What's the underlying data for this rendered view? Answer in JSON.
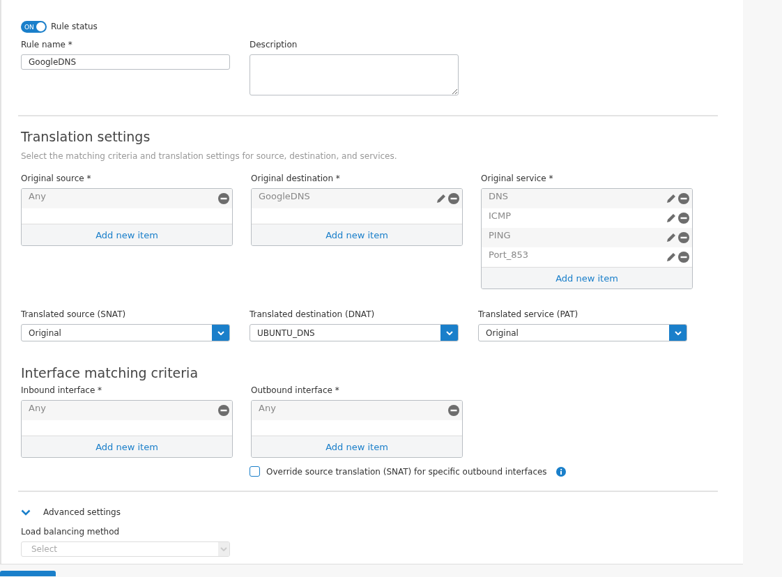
{
  "rule_status": {
    "label": "Rule status",
    "on": true,
    "toggle_text": "ON"
  },
  "rule_name": {
    "label": "Rule name *",
    "value": "GoogleDNS"
  },
  "description": {
    "label": "Description"
  },
  "translation": {
    "title": "Translation settings",
    "subtitle": "Select the matching criteria and translation settings for source, destination, and services.",
    "lists": [
      {
        "label": "Original source *",
        "items": [
          {
            "text": "Any",
            "editable": false
          }
        ],
        "add_label": "Add new item"
      },
      {
        "label": "Original destination *",
        "items": [
          {
            "text": "GoogleDNS",
            "editable": true
          }
        ],
        "add_label": "Add new item"
      },
      {
        "label": "Original service *",
        "items": [
          {
            "text": "DNS",
            "editable": true
          },
          {
            "text": "ICMP",
            "editable": true
          },
          {
            "text": "PING",
            "editable": true
          },
          {
            "text": "Port_853",
            "editable": true
          }
        ],
        "add_label": "Add new item"
      }
    ],
    "selects": [
      {
        "label": "Translated source (SNAT)",
        "value": "Original"
      },
      {
        "label": "Translated destination (DNAT)",
        "value": "UBUNTU_DNS"
      },
      {
        "label": "Translated service (PAT)",
        "value": "Original"
      }
    ]
  },
  "interface": {
    "title": "Interface matching criteria",
    "lists": [
      {
        "label": "Inbound interface *",
        "items": [
          {
            "text": "Any",
            "editable": false
          }
        ],
        "add_label": "Add new item"
      },
      {
        "label": "Outbound interface *",
        "items": [
          {
            "text": "Any",
            "editable": false
          }
        ],
        "add_label": "Add new item"
      }
    ],
    "checkbox": {
      "label": "Override source translation (SNAT) for specific outbound interfaces",
      "checked": false
    }
  },
  "advanced": {
    "label": "Advanced settings",
    "expanded": true,
    "load_balancing": {
      "label": "Load balancing method",
      "placeholder": "Select",
      "disabled": true
    }
  }
}
